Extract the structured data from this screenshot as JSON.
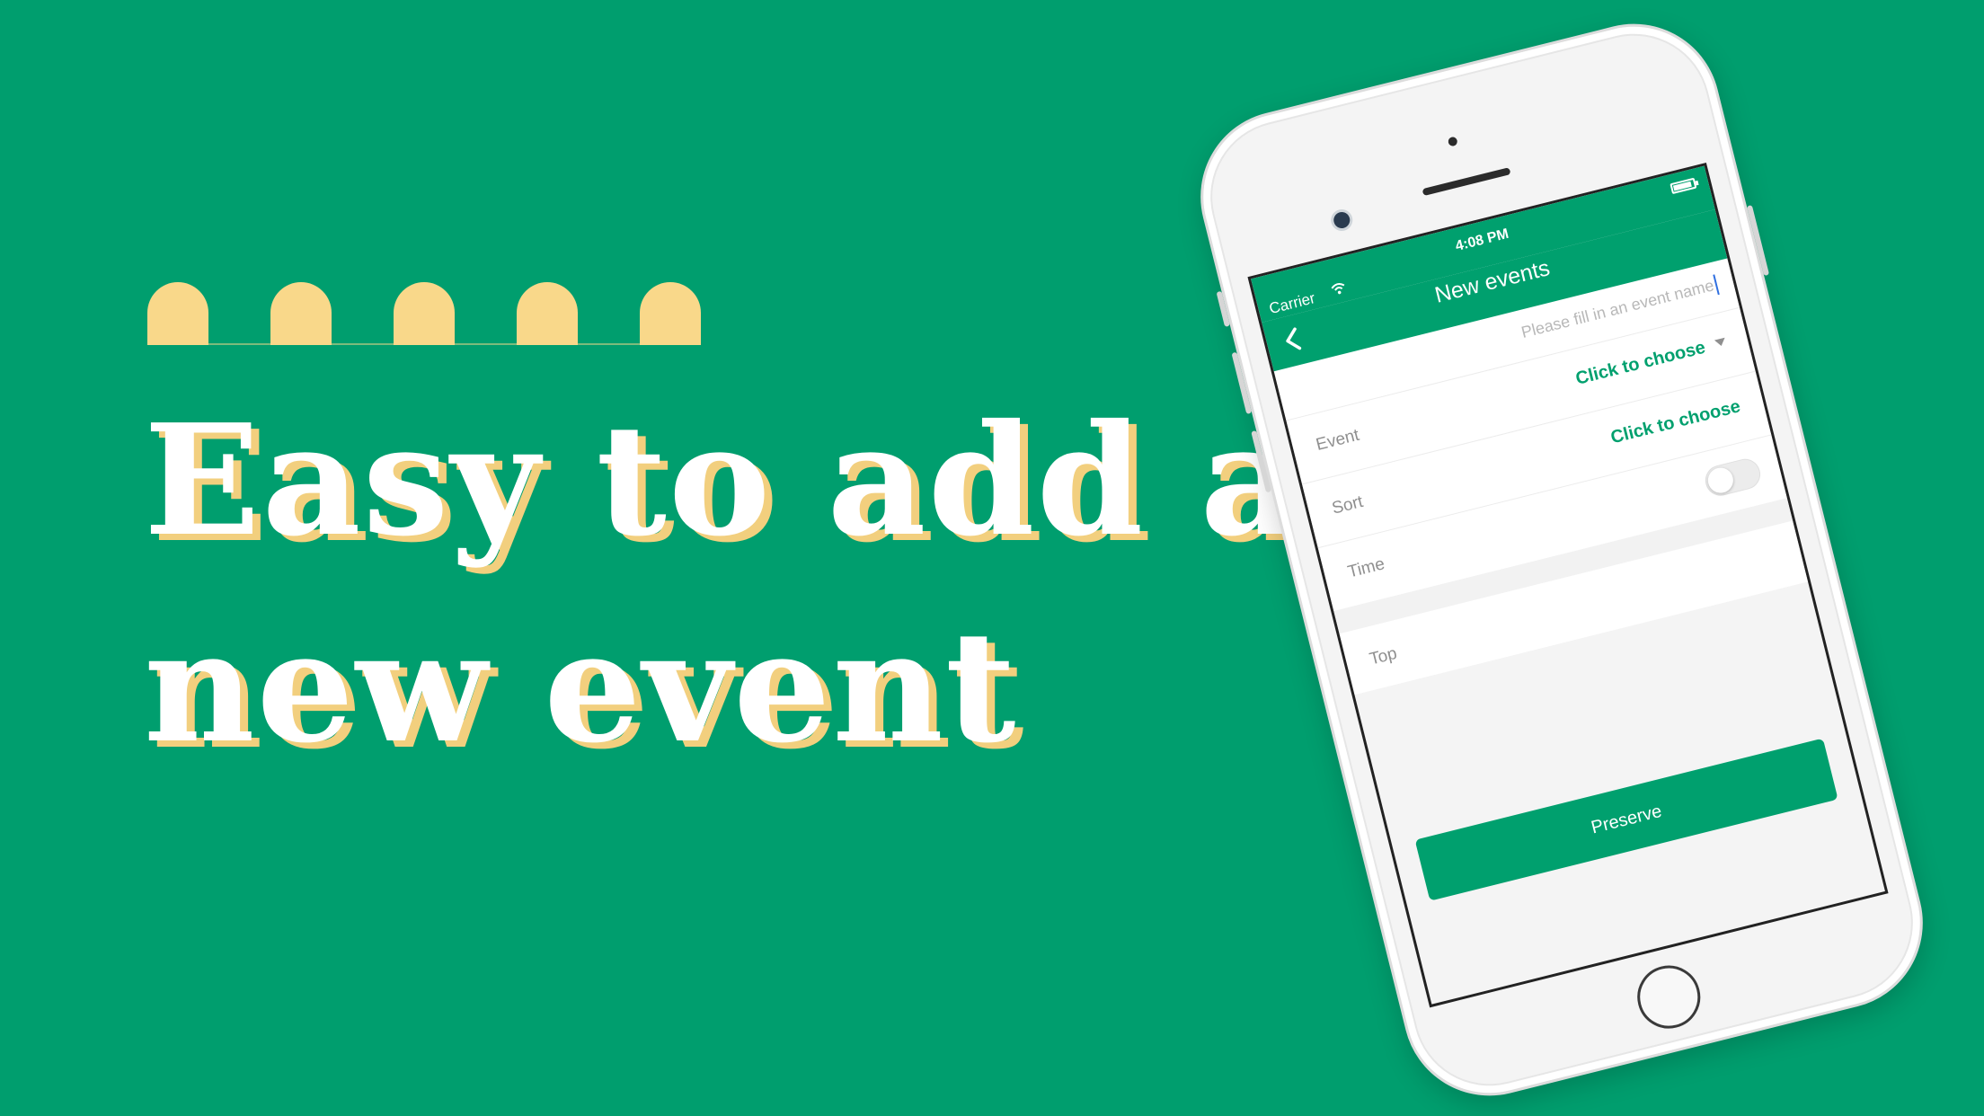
{
  "colors": {
    "background": "#009e6e",
    "accent_yellow": "#f9d88a",
    "app_green": "#00a06e"
  },
  "decoration": {
    "arch_count": 5
  },
  "headline": {
    "line1": "Easy to add a",
    "line2": "new event"
  },
  "status_bar": {
    "carrier": "Carrier",
    "time": "4:08 PM",
    "icons": [
      "wifi-icon",
      "battery-icon"
    ]
  },
  "nav": {
    "title": "New events",
    "back_icon": "chevron-left-icon"
  },
  "form": {
    "event_name": {
      "value": "",
      "placeholder": "Please fill in an event name"
    },
    "event": {
      "label": "Event",
      "value": "Click to choose"
    },
    "sort": {
      "label": "Sort",
      "value": "Click to choose"
    },
    "time": {
      "label": "Time",
      "toggle_on": false
    },
    "top": {
      "label": "Top"
    }
  },
  "actions": {
    "preserve_label": "Preserve"
  }
}
